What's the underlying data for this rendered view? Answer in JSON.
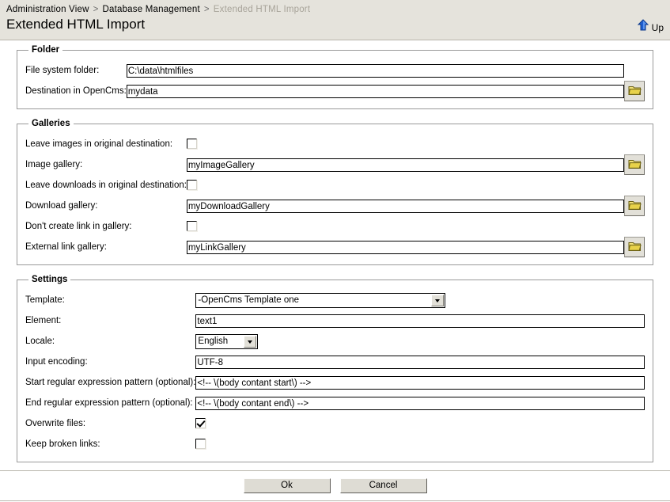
{
  "header": {
    "breadcrumb": [
      {
        "label": "Administration View",
        "current": false
      },
      {
        "label": "Database Management",
        "current": false
      },
      {
        "label": "Extended HTML Import",
        "current": true
      }
    ],
    "separator": ">",
    "title": "Extended HTML Import",
    "up_label": "Up",
    "up_icon": "up-arrow-icon"
  },
  "folder": {
    "legend": "Folder",
    "file_system_folder": {
      "label": "File system folder:",
      "value": "C:\\data\\htmlfiles"
    },
    "destination": {
      "label": "Destination in OpenCms:",
      "value": "mydata",
      "browse_icon": "folder-icon"
    }
  },
  "galleries": {
    "legend": "Galleries",
    "leave_images": {
      "label": "Leave images in original destination:",
      "checked": false
    },
    "image_gallery": {
      "label": "Image gallery:",
      "value": "myImageGallery",
      "browse_icon": "folder-icon"
    },
    "leave_downloads": {
      "label": "Leave downloads in original destination:",
      "checked": false
    },
    "download_gallery": {
      "label": "Download gallery:",
      "value": "myDownloadGallery",
      "browse_icon": "folder-icon"
    },
    "no_link_in_gallery": {
      "label": "Don't create link in gallery:",
      "checked": false
    },
    "external_link_gallery": {
      "label": "External link gallery:",
      "value": "myLinkGallery",
      "browse_icon": "folder-icon"
    }
  },
  "settings": {
    "legend": "Settings",
    "template": {
      "label": "Template:",
      "value": "-OpenCms Template one"
    },
    "element": {
      "label": "Element:",
      "value": "text1"
    },
    "locale": {
      "label": "Locale:",
      "value": "English"
    },
    "input_encoding": {
      "label": "Input encoding:",
      "value": "UTF-8"
    },
    "start_pattern": {
      "label": "Start regular expression pattern (optional):",
      "value": "<!-- \\(body contant start\\) -->"
    },
    "end_pattern": {
      "label": "End regular expression pattern (optional):",
      "value": "<!-- \\(body contant end\\) -->"
    },
    "overwrite_files": {
      "label": "Overwrite files:",
      "checked": true
    },
    "keep_broken_links": {
      "label": "Keep broken links:",
      "checked": false
    }
  },
  "footer": {
    "ok_label": "Ok",
    "cancel_label": "Cancel"
  },
  "colors": {
    "header_bg": "#e5e3dc",
    "breadcrumb_current": "#a8a49a",
    "button_face": "#dedcd4",
    "folder_icon": "#e8d24a"
  }
}
